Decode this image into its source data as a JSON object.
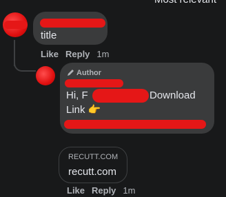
{
  "header": {
    "sort_label": "Most relevant"
  },
  "comment1": {
    "text": "title",
    "actions": {
      "like": "Like",
      "reply": "Reply",
      "time": "1m"
    }
  },
  "reply": {
    "author_badge": "Author",
    "line1_start": "Hi, F",
    "line1_end": "Download",
    "line2": "Link",
    "emoji": "👉",
    "link_preview": {
      "domain": "RECUTT.COM",
      "title": "recutt.com"
    },
    "actions": {
      "like": "Like",
      "reply": "Reply",
      "time": "1m"
    }
  },
  "colors": {
    "background": "#18191a",
    "bubble": "#3a3b3c",
    "redaction": "#e51717"
  }
}
